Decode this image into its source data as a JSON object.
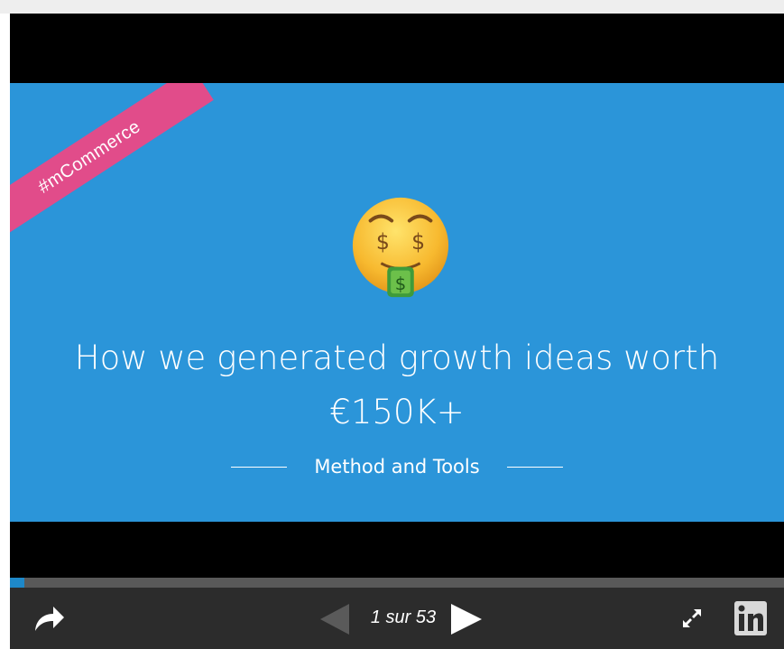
{
  "slide": {
    "tag": "#mCommerce",
    "title_line1": "How we generated growth ideas worth",
    "title_line2": "€150K+",
    "subtitle": "Method and Tools"
  },
  "player": {
    "counter": "1 sur 53",
    "current_slide": 1,
    "total_slides": 53,
    "progress_fraction": 0.019
  },
  "icons": {
    "share": "share-arrow-icon",
    "prev": "triangle-left-icon",
    "next": "triangle-right-icon",
    "fullscreen": "expand-arrows-icon",
    "linkedin": "linkedin-logo"
  },
  "colors": {
    "slide_bg": "#2b95d9",
    "ribbon": "#e14c8a",
    "controls_bg": "#2c2c2c",
    "progress": "#1e88c8"
  }
}
